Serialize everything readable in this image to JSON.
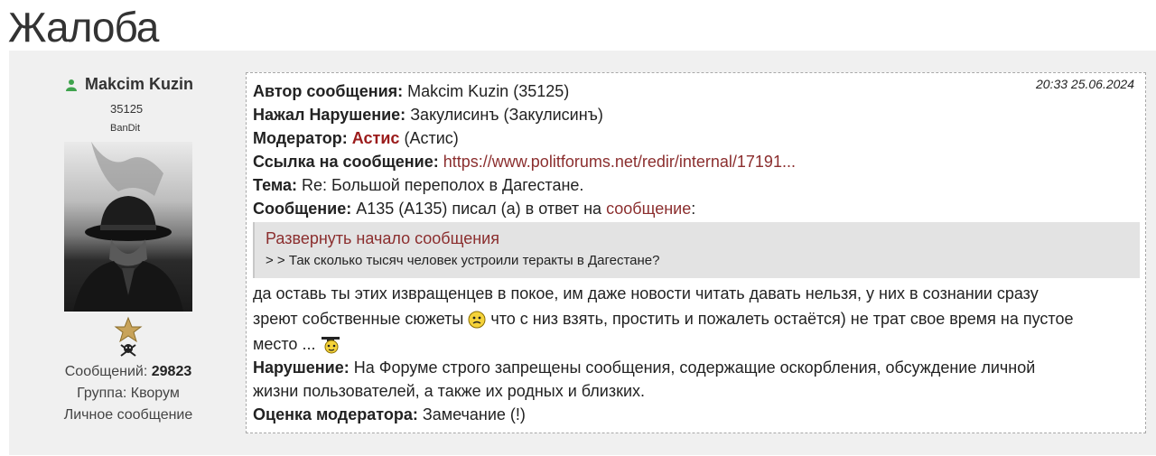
{
  "page": {
    "title": "Жалоба"
  },
  "user": {
    "name": "Makcim Kuzin",
    "id": "35125",
    "rank": "BanDit",
    "stats": {
      "messages_label": "Сообщений:",
      "messages_count": "29823",
      "group": "Группа: Кворум",
      "private_message": "Личное сообщение"
    },
    "colors": {
      "online": "#3fa34d"
    }
  },
  "complaint": {
    "timestamp": "20:33 25.06.2024",
    "author_label": "Автор сообщения:",
    "author_value": "Makcim Kuzin (35125)",
    "reporter_label": "Нажал Нарушение:",
    "reporter_value": "Закулисинъ (Закулисинъ)",
    "moderator_label": "Модератор:",
    "moderator_name": "Астис",
    "moderator_suffix": "(Астис)",
    "link_label": "Ссылка на сообщение:",
    "link_value": "https://www.politforums.net/redir/internal/17191...",
    "topic_label": "Тема:",
    "topic_value": "Re: Большой переполох в Дагестане.",
    "message_label": "Сообщение:",
    "message_value": "А135 (А135) писал (а) в ответ на",
    "message_link": "сообщение",
    "message_colon": ":",
    "quote_expand": "Развернуть начало сообщения",
    "quote_text": "> > Так сколько тысяч человек устроили теракты в Дагестане?",
    "body_line1": "да оставь ты этих извращенцев в покое, им даже новости читать давать нельзя, у них в сознании сразу",
    "body_line2a": "зреют собственные сюжеты",
    "body_line2b": "что с низ взять, простить и пожалеть остаётся) не трат свое время на пустое",
    "body_line3": "место ...",
    "violation_label": "Нарушение:",
    "violation_line1": "На Форуме строго запрещены сообщения, содержащие оскорбления, обсуждение личной",
    "violation_line2": "жизни пользователей, а также их родных и близких.",
    "rating_label": "Оценка модератора:",
    "rating_value": "Замечание (!)"
  },
  "icons": [
    "user-online-icon",
    "rank-star-icon",
    "skull-icon",
    "smiley-confused-icon",
    "smiley-graduate-icon"
  ],
  "colors": {
    "link": "#8b2e2e",
    "moderator": "#9b1b1b",
    "panel_bg": "#f0f0f0",
    "quote_bg": "#e3e3e3"
  }
}
